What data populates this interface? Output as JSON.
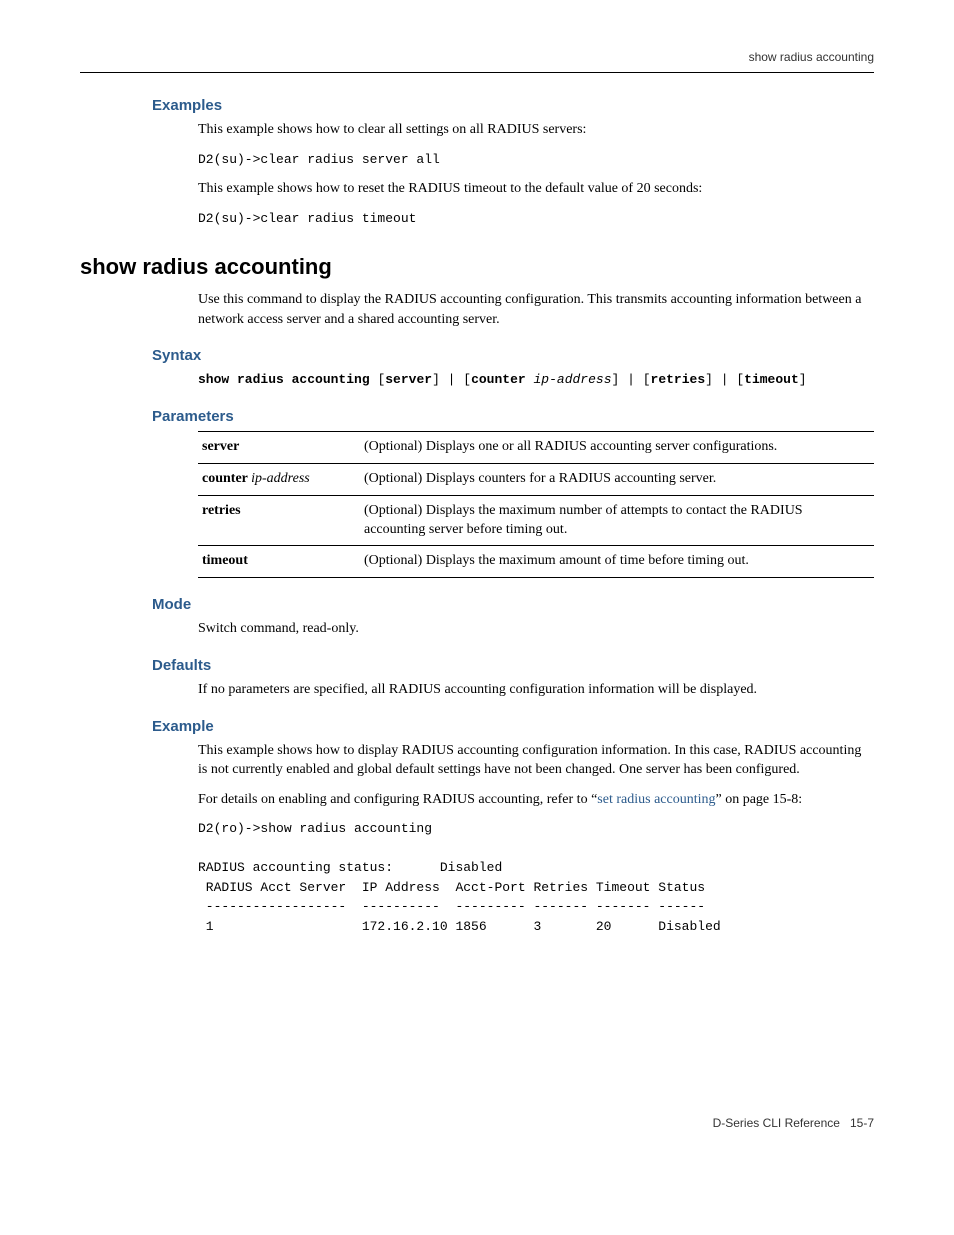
{
  "header": {
    "running_title": "show radius accounting"
  },
  "sections": {
    "examples_h": "Examples",
    "examples_p1": "This example shows how to clear all settings on all RADIUS servers:",
    "examples_code1": "D2(su)->clear radius server all",
    "examples_p2": "This example shows how to reset the RADIUS timeout to the default value of 20 seconds:",
    "examples_code2": "D2(su)->clear radius timeout"
  },
  "command": {
    "title": "show radius accounting",
    "desc": "Use this command to display the RADIUS accounting configuration. This transmits accounting information between a network access server and a shared accounting server."
  },
  "syntax": {
    "h": "Syntax",
    "tokens": {
      "cmd": "show radius accounting",
      "open1": " [",
      "server": "server",
      "close1": "] | [",
      "counter": "counter",
      "sp": " ",
      "ip": "ip-address",
      "close2": "] | [",
      "retries": "retries",
      "close3": "] | [",
      "timeout": "timeout",
      "close4": "]"
    }
  },
  "parameters": {
    "h": "Parameters",
    "rows": [
      {
        "key": "server",
        "var": "",
        "desc": "(Optional) Displays one or all RADIUS accounting server configurations."
      },
      {
        "key": "counter",
        "var": "ip-address",
        "desc": "(Optional) Displays counters for a RADIUS accounting server."
      },
      {
        "key": "retries",
        "var": "",
        "desc": "(Optional) Displays the maximum number of attempts to contact the RADIUS accounting server before timing out."
      },
      {
        "key": "timeout",
        "var": "",
        "desc": "(Optional) Displays the maximum amount of time before timing out."
      }
    ]
  },
  "mode": {
    "h": "Mode",
    "text": "Switch command, read-only."
  },
  "defaults": {
    "h": "Defaults",
    "text": "If no parameters are specified, all RADIUS accounting configuration information will be displayed."
  },
  "example": {
    "h": "Example",
    "p1": "This example shows how to display RADIUS accounting configuration information. In this case, RADIUS accounting is not currently enabled and global default settings have not been changed. One server has been configured.",
    "p2a": "For details on enabling and configuring RADIUS accounting, refer to “",
    "p2_link": "set radius accounting",
    "p2b": "” on page 15-8:",
    "output": "D2(ro)->show radius accounting\n\nRADIUS accounting status:      Disabled\n RADIUS Acct Server  IP Address  Acct-Port Retries Timeout Status\n ------------------  ----------  --------- ------- ------- ------\n 1                   172.16.2.10 1856      3       20      Disabled"
  },
  "footer": {
    "ref": "D-Series CLI Reference",
    "page": "15-7"
  },
  "chart_data": {
    "type": "table",
    "title": "RADIUS accounting status: Disabled",
    "columns": [
      "RADIUS Acct Server",
      "IP Address",
      "Acct-Port",
      "Retries",
      "Timeout",
      "Status"
    ],
    "rows": [
      [
        "1",
        "172.16.2.10",
        1856,
        3,
        20,
        "Disabled"
      ]
    ]
  }
}
